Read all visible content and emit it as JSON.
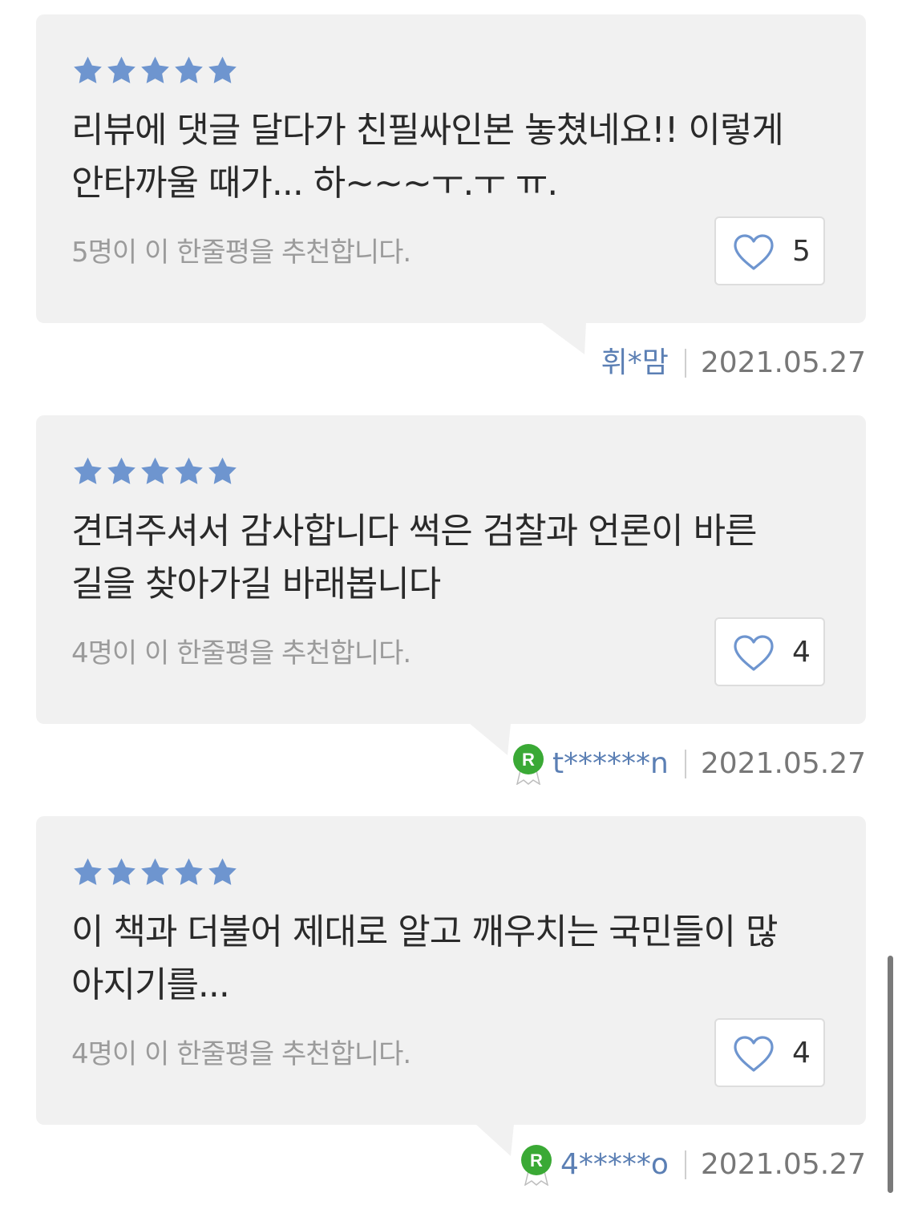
{
  "reviews": [
    {
      "rating": 5,
      "text_line1": "리뷰에 댓글 달다가 친필싸인본 놓쳤네요!! 이렇게",
      "text_line2": "안타까울 때가... 하~~~ㅜ.ㅜ ㅠ.",
      "recommend_text": "5명이 이 한줄평을 추천합니다.",
      "like_count": "5",
      "nickname": "휘*맘",
      "date": "2021.05.27",
      "has_badge": false,
      "badge_letter": ""
    },
    {
      "rating": 5,
      "text_line1": "견뎌주셔서 감사합니다 썩은 검찰과 언론이 바른",
      "text_line2": "길을 찾아가길 바래봅니다",
      "recommend_text": "4명이 이 한줄평을 추천합니다.",
      "like_count": "4",
      "nickname": "t******n",
      "date": "2021.05.27",
      "has_badge": true,
      "badge_letter": "R"
    },
    {
      "rating": 5,
      "text_line1": "이 책과 더불어 제대로 알고 깨우치는 국민들이 많",
      "text_line2": "아지기를...",
      "recommend_text": "4명이 이 한줄평을 추천합니다.",
      "like_count": "4",
      "nickname": "4*****o",
      "date": "2021.05.27",
      "has_badge": true,
      "badge_letter": "R"
    }
  ],
  "colors": {
    "card_bg": "#f1f1f1",
    "star": "#6e95cf",
    "heart": "#6e95cf",
    "nickname": "#5b7fb4",
    "badge_green": "#3aa935"
  },
  "icons": {
    "star": "star-icon",
    "heart": "heart-icon",
    "badge": "reader-rank-badge-icon"
  }
}
